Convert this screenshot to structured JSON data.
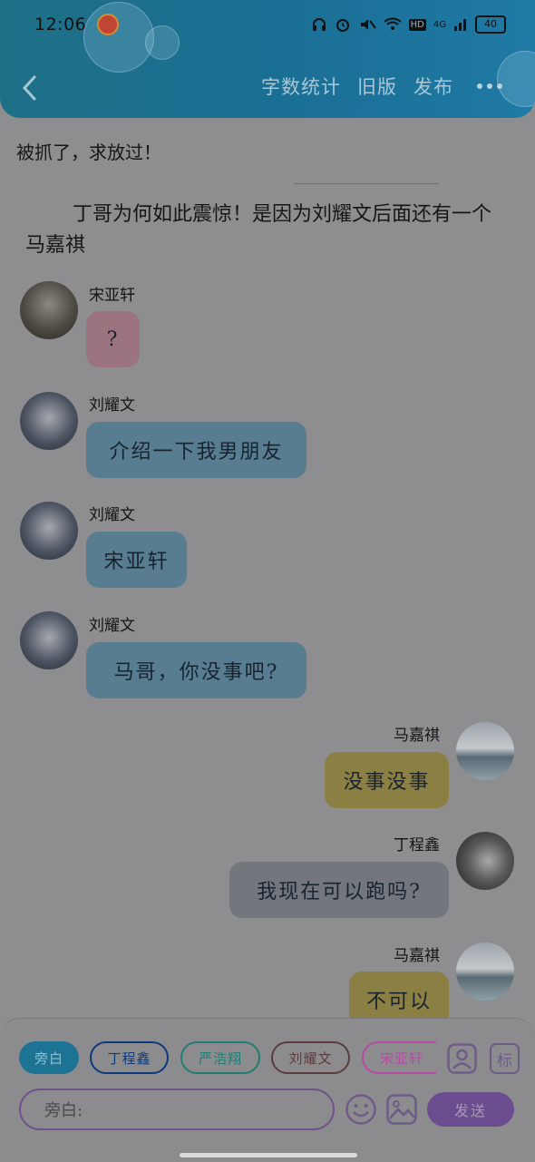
{
  "status_bar": {
    "time": "12:06",
    "network": "4G",
    "hd": "HD",
    "battery": "40"
  },
  "header": {
    "word_count": "字数统计",
    "old_version": "旧版",
    "publish": "发布"
  },
  "content": {
    "narration_1": "被抓了，求放过！",
    "narration_2": "丁哥为何如此震惊！是因为刘耀文后面还有一个马嘉祺",
    "messages": [
      {
        "side": "left",
        "name": "宋亚轩",
        "text": "?",
        "color": "#9b7480"
      },
      {
        "side": "left",
        "name": "刘耀文",
        "text": "介绍一下我男朋友",
        "color": "#587c90"
      },
      {
        "side": "left",
        "name": "刘耀文",
        "text": "宋亚轩",
        "color": "#587c90"
      },
      {
        "side": "left",
        "name": "刘耀文",
        "text": "马哥，你没事吧?",
        "color": "#587c90"
      },
      {
        "side": "right",
        "name": "马嘉祺",
        "text": "没事没事",
        "color": "#8c7f44"
      },
      {
        "side": "right",
        "name": "丁程鑫",
        "text": "我现在可以跑吗?",
        "color": "#73767d"
      },
      {
        "side": "right",
        "name": "马嘉祺",
        "text": "不可以",
        "color": "#8c7f44"
      }
    ]
  },
  "composer": {
    "tags": [
      {
        "label": "旁白",
        "selected": true,
        "color": "#1d7394"
      },
      {
        "label": "丁程鑫",
        "color": "#0d3a7a"
      },
      {
        "label": "严浩翔",
        "color": "#1f7d72"
      },
      {
        "label": "刘耀文",
        "color": "#5a3c3c"
      },
      {
        "label": "宋亚轩",
        "color": "#b64ba4"
      }
    ],
    "mark_label": "标",
    "placeholder": "旁白:",
    "send_label": "发送"
  }
}
